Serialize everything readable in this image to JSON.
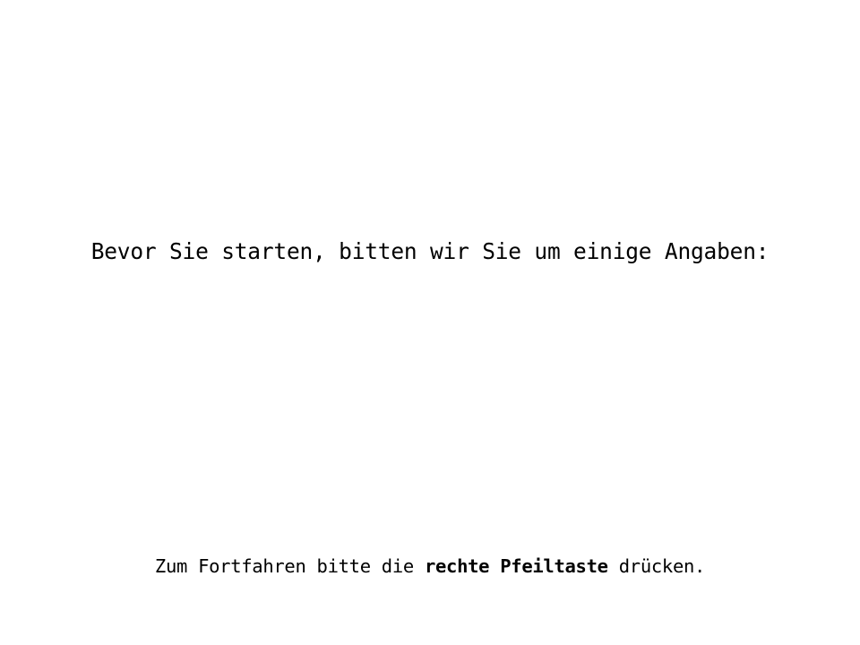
{
  "screen": {
    "heading": "Bevor Sie starten, bitten wir Sie um einige Angaben:",
    "footer": {
      "before": "Zum Fortfahren bitte die ",
      "key": "rechte Pfeiltaste",
      "after": " drücken."
    }
  },
  "colors": {
    "background": "#ffffff",
    "text": "#000000"
  }
}
